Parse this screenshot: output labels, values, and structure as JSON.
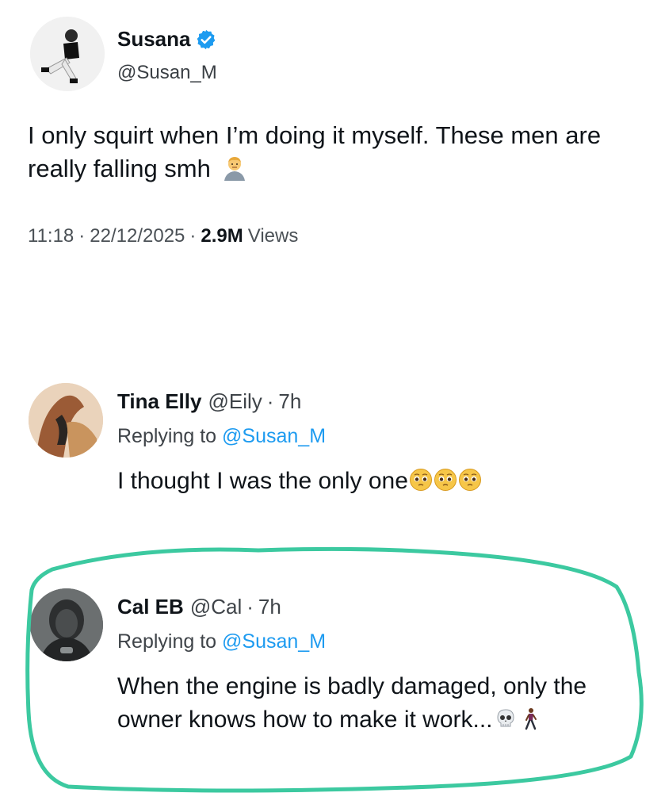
{
  "main_tweet": {
    "name": "Susana",
    "handle": "@Susan_M",
    "text": "I only squirt when I’m doing it myself. These men are really falling smh",
    "emoji": "man-shrugging-emoji",
    "time": "11:18",
    "date": "22/12/2025",
    "views_count": "2.9M",
    "views_label": "Views",
    "separator": "·"
  },
  "replies": [
    {
      "name": "Tina Elly",
      "handle": "@Eily",
      "time": "7h",
      "replying_prefix": "Replying to",
      "replying_to": "@Susan_M",
      "text": "I thought I was the only one",
      "emojis": [
        "pleading-face-emoji",
        "pleading-face-emoji",
        "pleading-face-emoji"
      ]
    },
    {
      "name": "Cal EB",
      "handle": "@Cal",
      "time": "7h",
      "replying_prefix": "Replying to",
      "replying_to": "@Susan_M",
      "text": "When the engine is badly damaged, only the owner knows how to make it work...",
      "emojis": [
        "skull-emoji",
        "person-walking-emoji"
      ]
    }
  ],
  "colors": {
    "accent": "#1d9bf0",
    "highlight": "#3cc9a0"
  }
}
